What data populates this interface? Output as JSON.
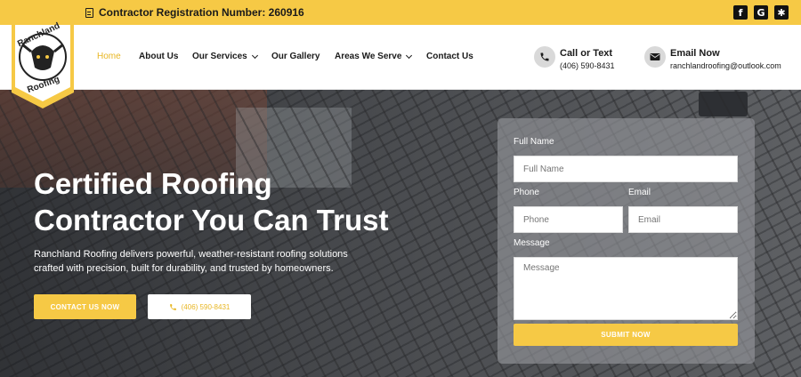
{
  "topbar": {
    "registration": "Contractor Registration Number: 260916",
    "social": [
      {
        "name": "facebook",
        "glyph": "f"
      },
      {
        "name": "google",
        "glyph": "G"
      },
      {
        "name": "yelp",
        "glyph": "✱"
      }
    ]
  },
  "brand": {
    "logo_text_top": "Ranchland",
    "logo_text_bottom": "Roofing",
    "accent": "#f6c945"
  },
  "nav": {
    "items": [
      {
        "label": "Home",
        "active": true
      },
      {
        "label": "About Us"
      },
      {
        "label": "Our Services",
        "dropdown": true
      },
      {
        "label": "Our Gallery"
      },
      {
        "label": "Areas We Serve",
        "dropdown": true
      },
      {
        "label": "Contact Us"
      }
    ],
    "call": {
      "title": "Call or Text",
      "value": "(406) 590-8431"
    },
    "email": {
      "title": "Email Now",
      "value": "ranchlandroofing@outlook.com"
    }
  },
  "hero": {
    "title_line1": "Certified Roofing",
    "title_line2": "Contractor You Can Trust",
    "description": "Ranchland Roofing delivers powerful, weather-resistant roofing solutions crafted with precision, built for durability, and trusted by homeowners.",
    "cta_primary": "CONTACT US NOW",
    "cta_secondary": "(406) 590-8431"
  },
  "form": {
    "fullname_label": "Full Name",
    "fullname_placeholder": "Full Name",
    "phone_label": "Phone",
    "phone_placeholder": "Phone",
    "email_label": "Email",
    "email_placeholder": "Email",
    "message_label": "Message",
    "message_placeholder": "Message",
    "submit": "SUBMIT NOW"
  }
}
